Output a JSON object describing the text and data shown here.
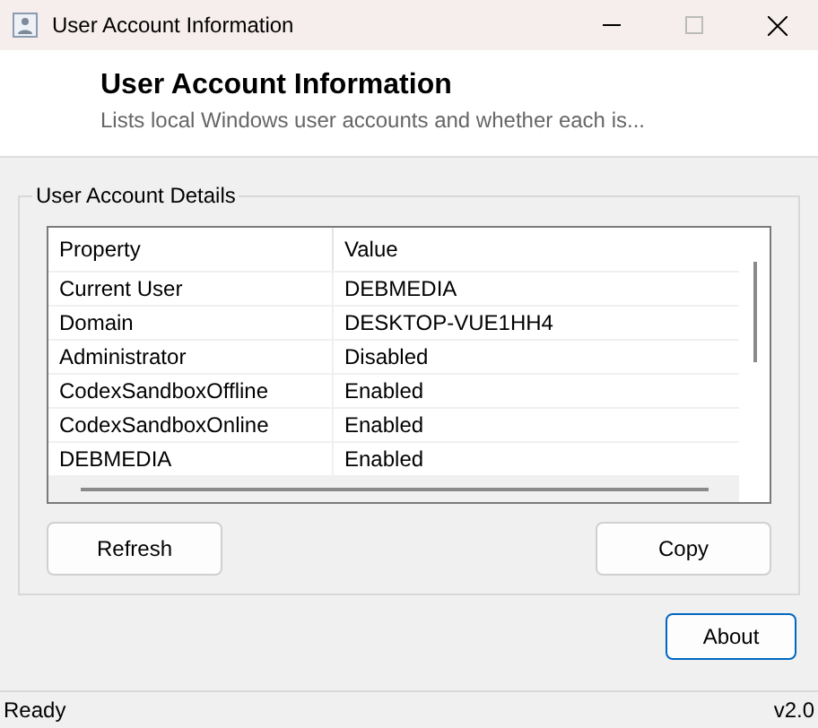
{
  "window": {
    "title": "User Account Information"
  },
  "header": {
    "title": "User Account Information",
    "subtitle": "Lists local Windows user accounts and whether each is..."
  },
  "group": {
    "title": "User Account Details",
    "table": {
      "columns": [
        "Property",
        "Value"
      ],
      "rows": [
        {
          "cells": [
            "Current User",
            "DEBMEDIA"
          ]
        },
        {
          "cells": [
            "Domain",
            "DESKTOP-VUE1HH4"
          ]
        },
        {
          "cells": [
            "Administrator",
            "Disabled"
          ]
        },
        {
          "cells": [
            "CodexSandboxOffline",
            "Enabled"
          ]
        },
        {
          "cells": [
            "CodexSandboxOnline",
            "Enabled"
          ]
        },
        {
          "cells": [
            "DEBMEDIA",
            "Enabled"
          ]
        }
      ]
    },
    "buttons": [
      {
        "label": "Refresh",
        "focused": false
      },
      {
        "label": "Copy",
        "focused": false
      }
    ]
  },
  "about_button": {
    "label": "About",
    "focused": true
  },
  "status_bar": {
    "status": "Ready",
    "version": "v2.0"
  }
}
